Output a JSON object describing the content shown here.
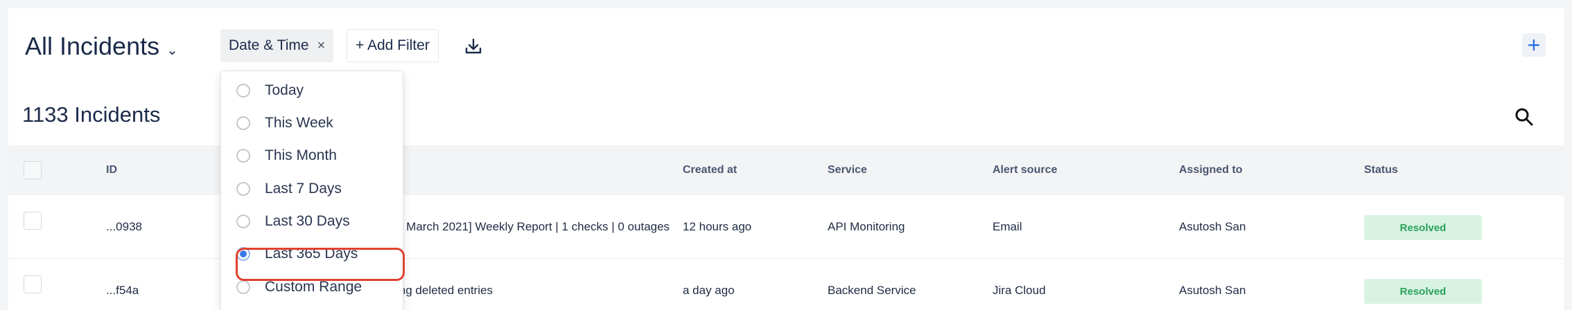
{
  "header": {
    "title": "All Incidents",
    "filter_chip": "Date & Time",
    "filter_chip_close": "×",
    "add_filter": "+ Add Filter",
    "plus": "+"
  },
  "summary": {
    "count_label": "1133 Incidents"
  },
  "table": {
    "columns": [
      "ID",
      "",
      "Created at",
      "Service",
      "Alert source",
      "Assigned to",
      "Status"
    ],
    "rows": [
      {
        "id": "...0938",
        "title": "3 March 2021] Weekly Report | 1 checks | 0 outages",
        "created": "12 hours ago",
        "service": "API Monitoring",
        "source": "Email",
        "assigned": "Asutosh San",
        "status": "Resolved"
      },
      {
        "id": "...f54a",
        "title": "ing deleted entries",
        "created": "a day ago",
        "service": "Backend Service",
        "source": "Jira Cloud",
        "assigned": "Asutosh San",
        "status": "Resolved"
      }
    ]
  },
  "dropdown": {
    "options": [
      "Today",
      "This Week",
      "This Month",
      "Last 7 Days",
      "Last 30 Days",
      "Last 365 Days",
      "Custom Range"
    ],
    "selected": "Last 365 Days"
  },
  "colors": {
    "accent": "#3b78e7",
    "status_bg": "#d8f3e2",
    "status_text": "#2aa15a",
    "highlight": "#e0412f"
  },
  "icons": {
    "title_caret": "chevron-down-icon",
    "download": "download-icon",
    "search": "search-icon",
    "add": "plus-icon"
  }
}
